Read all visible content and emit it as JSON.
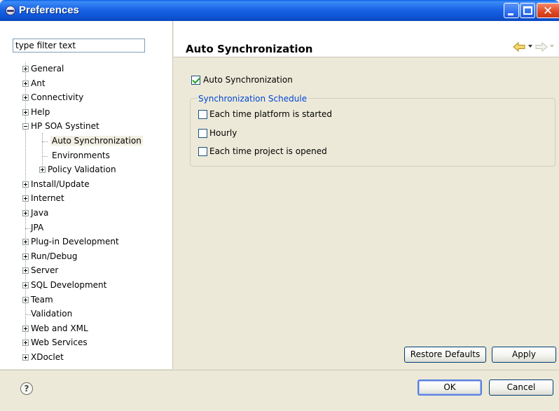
{
  "window": {
    "title": "Preferences"
  },
  "filter": {
    "placeholder": "type filter text"
  },
  "tree": {
    "items": [
      {
        "label": "General",
        "expander": "plus"
      },
      {
        "label": "Ant",
        "expander": "plus"
      },
      {
        "label": "Connectivity",
        "expander": "plus"
      },
      {
        "label": "Help",
        "expander": "plus"
      },
      {
        "label": "HP SOA Systinet",
        "expander": "minus"
      },
      {
        "label": "Auto Synchronization",
        "expander": "none",
        "selected": true
      },
      {
        "label": "Environments",
        "expander": "none"
      },
      {
        "label": "Policy Validation",
        "expander": "plus"
      },
      {
        "label": "Install/Update",
        "expander": "plus"
      },
      {
        "label": "Internet",
        "expander": "plus"
      },
      {
        "label": "Java",
        "expander": "plus"
      },
      {
        "label": "JPA",
        "expander": "none"
      },
      {
        "label": "Plug-in Development",
        "expander": "plus"
      },
      {
        "label": "Run/Debug",
        "expander": "plus"
      },
      {
        "label": "Server",
        "expander": "plus"
      },
      {
        "label": "SQL Development",
        "expander": "plus"
      },
      {
        "label": "Team",
        "expander": "plus"
      },
      {
        "label": "Validation",
        "expander": "none"
      },
      {
        "label": "Web and XML",
        "expander": "plus"
      },
      {
        "label": "Web Services",
        "expander": "plus"
      },
      {
        "label": "XDoclet",
        "expander": "plus"
      }
    ]
  },
  "page": {
    "title": "Auto Synchronization",
    "auto_sync_label": "Auto Synchronization",
    "auto_sync_checked": true,
    "schedule_group_title": "Synchronization Schedule",
    "schedule_options": [
      {
        "label": "Each time platform is started",
        "checked": false
      },
      {
        "label": "Hourly",
        "checked": false
      },
      {
        "label": "Each time project is opened",
        "checked": false
      }
    ],
    "restore_defaults_label": "Restore Defaults",
    "apply_label": "Apply"
  },
  "footer": {
    "help_glyph": "?",
    "ok_label": "OK",
    "cancel_label": "Cancel"
  },
  "colors": {
    "titlebar": "#0a5fe6",
    "group_title": "#0046d5",
    "check": "#21a121"
  }
}
